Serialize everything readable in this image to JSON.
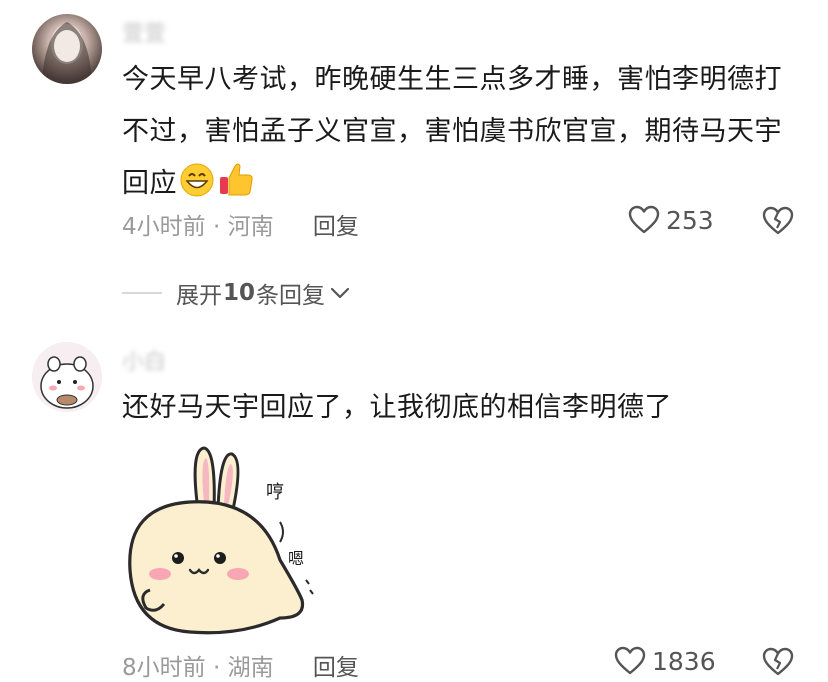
{
  "comments": [
    {
      "username": "萱萱",
      "text": "今天早八考试，昨晚硬生生三点多才睡，害怕李明德打不过，害怕孟子义官宣，害怕虞书欣官宣，期待马天宇回应",
      "time": "4小时前",
      "separator": "·",
      "location": "河南",
      "reply_label": "回复",
      "likes": "253",
      "emojis": [
        "grinning-face-emoji",
        "thumbs-up-emoji"
      ]
    },
    {
      "username": "小白",
      "text": "还好马天宇回应了，让我彻底的相信李明德了",
      "time": "8小时前",
      "separator": "·",
      "location": "湖南",
      "reply_label": "回复",
      "likes": "1836",
      "sticker": {
        "text_top": "哼",
        "text_side": "嗯"
      }
    }
  ],
  "expand": {
    "prefix": "展开",
    "count": "10",
    "suffix": "条回复"
  },
  "icons": {
    "like": "heart-outline-icon",
    "dislike": "broken-heart-icon",
    "chevron": "chevron-down-icon"
  },
  "colors": {
    "text": "#1a1a1a",
    "meta": "#9a9a9a",
    "action": "#555555"
  }
}
